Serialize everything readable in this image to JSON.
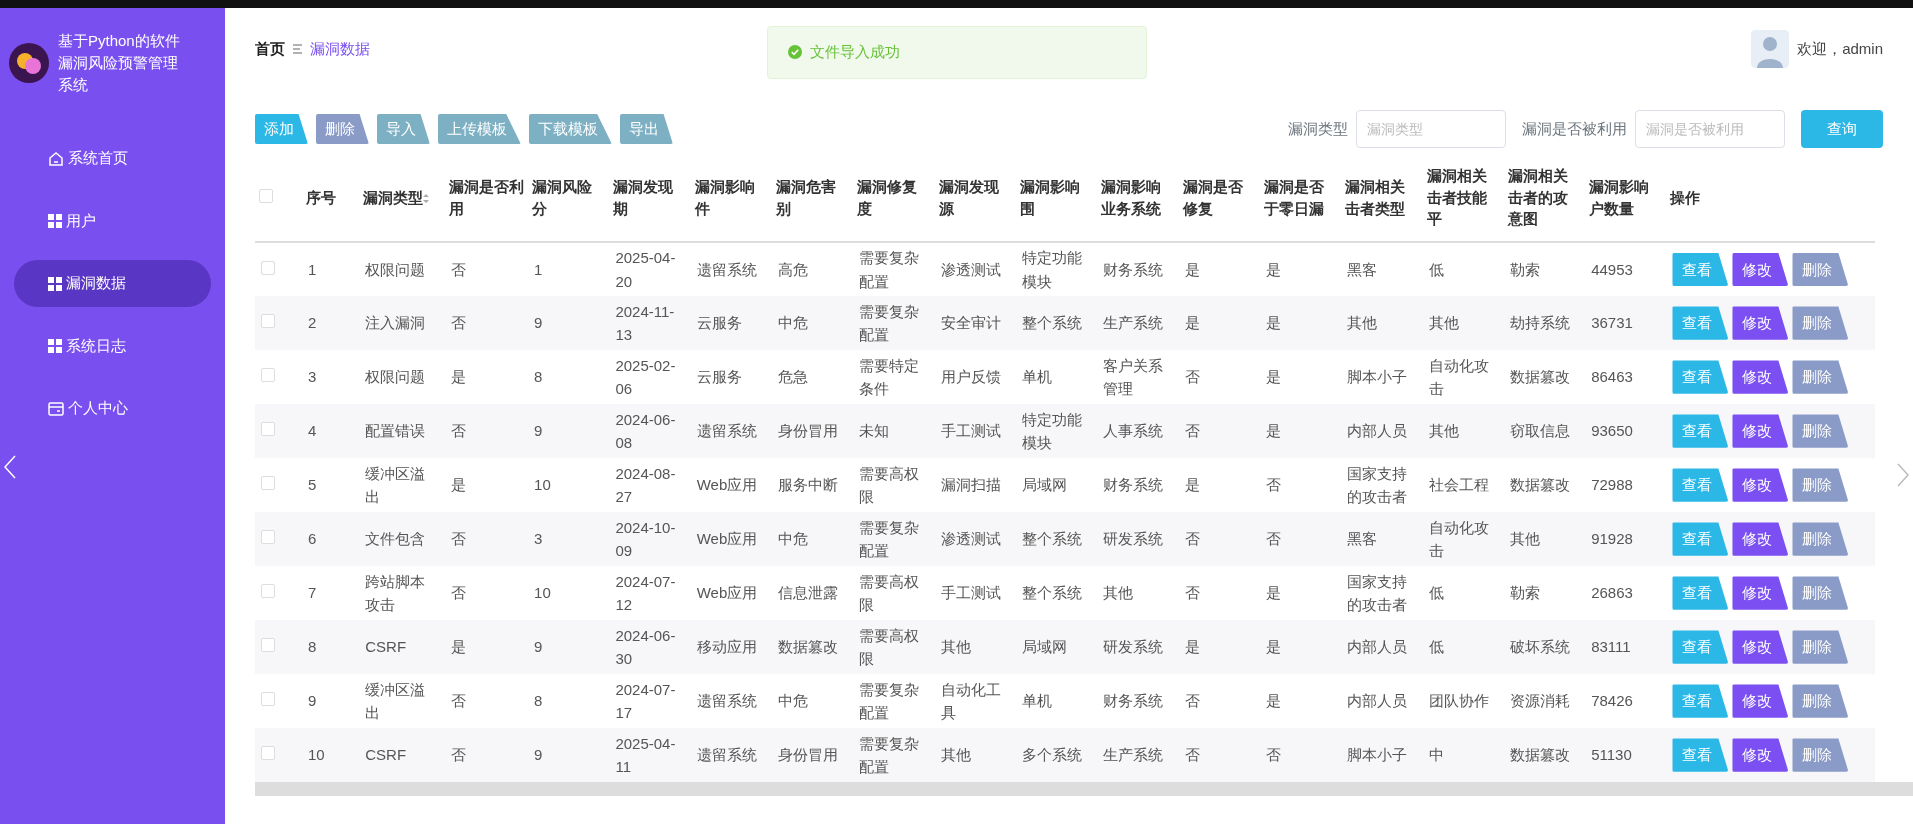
{
  "sidebar": {
    "title": "基于Python的软件漏洞风险预警管理系统",
    "items": [
      {
        "label": "系统首页",
        "kind": "home",
        "selected": false
      },
      {
        "label": "用户",
        "kind": "grid",
        "selected": false
      },
      {
        "label": "漏洞数据",
        "kind": "grid",
        "selected": true
      },
      {
        "label": "系统日志",
        "kind": "grid",
        "selected": false
      },
      {
        "label": "个人中心",
        "kind": "card",
        "selected": false
      }
    ]
  },
  "breadcrumb": {
    "home": "首页",
    "current": "漏洞数据"
  },
  "toast": {
    "message": "文件导入成功"
  },
  "user": {
    "greeting": "欢迎，admin"
  },
  "toolbar": {
    "buttons": [
      {
        "label": "添加",
        "kind": "add"
      },
      {
        "label": "删除",
        "kind": "delete"
      },
      {
        "label": "导入",
        "kind": "plain"
      },
      {
        "label": "上传模板",
        "kind": "plain"
      },
      {
        "label": "下载模板",
        "kind": "plain"
      },
      {
        "label": "导出",
        "kind": "plain"
      }
    ]
  },
  "search": {
    "fields": [
      {
        "label": "漏洞类型",
        "placeholder": "漏洞类型"
      },
      {
        "label": "漏洞是否被利用",
        "placeholder": "漏洞是否被利用"
      }
    ],
    "button": "查询"
  },
  "table": {
    "select_all_checked": false,
    "columns": [
      "序号",
      "漏洞类型",
      "漏洞是否利用",
      "漏洞风险分",
      "漏洞发现期",
      "漏洞影响件",
      "漏洞危害别",
      "漏洞修复度",
      "漏洞发现源",
      "漏洞影响围",
      "漏洞影响业务系统",
      "漏洞是否修复",
      "漏洞是否于零日漏",
      "漏洞相关击者类型",
      "漏洞相关击者技能平",
      "漏洞相关击者的攻意图",
      "漏洞影响户数量",
      "操作"
    ],
    "rows": [
      {
        "checked": false,
        "cells": [
          "1",
          "权限问题",
          "否",
          "1",
          "2025-04-20",
          "遗留系统",
          "高危",
          "需要复杂配置",
          "渗透测试",
          "特定功能模块",
          "财务系统",
          "是",
          "是",
          "黑客",
          "低",
          "勒索",
          "44953"
        ],
        "actions": [
          {
            "label": "查看",
            "kind": "view"
          },
          {
            "label": "修改",
            "kind": "edit"
          },
          {
            "label": "删除",
            "kind": "delete"
          }
        ]
      },
      {
        "checked": false,
        "cells": [
          "2",
          "注入漏洞",
          "否",
          "9",
          "2024-11-13",
          "云服务",
          "中危",
          "需要复杂配置",
          "安全审计",
          "整个系统",
          "生产系统",
          "是",
          "是",
          "其他",
          "其他",
          "劫持系统",
          "36731"
        ],
        "actions": [
          {
            "label": "查看",
            "kind": "view"
          },
          {
            "label": "修改",
            "kind": "edit"
          },
          {
            "label": "删除",
            "kind": "delete"
          }
        ]
      },
      {
        "checked": false,
        "cells": [
          "3",
          "权限问题",
          "是",
          "8",
          "2025-02-06",
          "云服务",
          "危急",
          "需要特定条件",
          "用户反馈",
          "单机",
          "客户关系管理",
          "否",
          "是",
          "脚本小子",
          "自动化攻击",
          "数据篡改",
          "86463"
        ],
        "actions": [
          {
            "label": "查看",
            "kind": "view"
          },
          {
            "label": "修改",
            "kind": "edit"
          },
          {
            "label": "删除",
            "kind": "delete"
          }
        ]
      },
      {
        "checked": false,
        "cells": [
          "4",
          "配置错误",
          "否",
          "9",
          "2024-06-08",
          "遗留系统",
          "身份冒用",
          "未知",
          "手工测试",
          "特定功能模块",
          "人事系统",
          "否",
          "是",
          "内部人员",
          "其他",
          "窃取信息",
          "93650"
        ],
        "actions": [
          {
            "label": "查看",
            "kind": "view"
          },
          {
            "label": "修改",
            "kind": "edit"
          },
          {
            "label": "删除",
            "kind": "delete"
          }
        ]
      },
      {
        "checked": false,
        "cells": [
          "5",
          "缓冲区溢出",
          "是",
          "10",
          "2024-08-27",
          "Web应用",
          "服务中断",
          "需要高权限",
          "漏洞扫描",
          "局域网",
          "财务系统",
          "是",
          "否",
          "国家支持的攻击者",
          "社会工程",
          "数据篡改",
          "72988"
        ],
        "actions": [
          {
            "label": "查看",
            "kind": "view"
          },
          {
            "label": "修改",
            "kind": "edit"
          },
          {
            "label": "删除",
            "kind": "delete"
          }
        ]
      },
      {
        "checked": false,
        "cells": [
          "6",
          "文件包含",
          "否",
          "3",
          "2024-10-09",
          "Web应用",
          "中危",
          "需要复杂配置",
          "渗透测试",
          "整个系统",
          "研发系统",
          "否",
          "否",
          "黑客",
          "自动化攻击",
          "其他",
          "91928"
        ],
        "actions": [
          {
            "label": "查看",
            "kind": "view"
          },
          {
            "label": "修改",
            "kind": "edit"
          },
          {
            "label": "删除",
            "kind": "delete"
          }
        ]
      },
      {
        "checked": false,
        "cells": [
          "7",
          "跨站脚本攻击",
          "否",
          "10",
          "2024-07-12",
          "Web应用",
          "信息泄露",
          "需要高权限",
          "手工测试",
          "整个系统",
          "其他",
          "否",
          "是",
          "国家支持的攻击者",
          "低",
          "勒索",
          "26863"
        ],
        "actions": [
          {
            "label": "查看",
            "kind": "view"
          },
          {
            "label": "修改",
            "kind": "edit"
          },
          {
            "label": "删除",
            "kind": "delete"
          }
        ]
      },
      {
        "checked": false,
        "cells": [
          "8",
          "CSRF",
          "是",
          "9",
          "2024-06-30",
          "移动应用",
          "数据篡改",
          "需要高权限",
          "其他",
          "局域网",
          "研发系统",
          "是",
          "是",
          "内部人员",
          "低",
          "破坏系统",
          "83111"
        ],
        "actions": [
          {
            "label": "查看",
            "kind": "view"
          },
          {
            "label": "修改",
            "kind": "edit"
          },
          {
            "label": "删除",
            "kind": "delete"
          }
        ]
      },
      {
        "checked": false,
        "cells": [
          "9",
          "缓冲区溢出",
          "否",
          "8",
          "2024-07-17",
          "遗留系统",
          "中危",
          "需要复杂配置",
          "自动化工具",
          "单机",
          "财务系统",
          "否",
          "是",
          "内部人员",
          "团队协作",
          "资源消耗",
          "78426"
        ],
        "actions": [
          {
            "label": "查看",
            "kind": "view"
          },
          {
            "label": "修改",
            "kind": "edit"
          },
          {
            "label": "删除",
            "kind": "delete"
          }
        ]
      },
      {
        "checked": false,
        "cells": [
          "10",
          "CSRF",
          "否",
          "9",
          "2025-04-11",
          "遗留系统",
          "身份冒用",
          "需要复杂配置",
          "其他",
          "多个系统",
          "生产系统",
          "否",
          "否",
          "脚本小子",
          "中",
          "数据篡改",
          "51130"
        ],
        "actions": [
          {
            "label": "查看",
            "kind": "view"
          },
          {
            "label": "修改",
            "kind": "edit"
          },
          {
            "label": "删除",
            "kind": "delete"
          }
        ]
      }
    ]
  }
}
